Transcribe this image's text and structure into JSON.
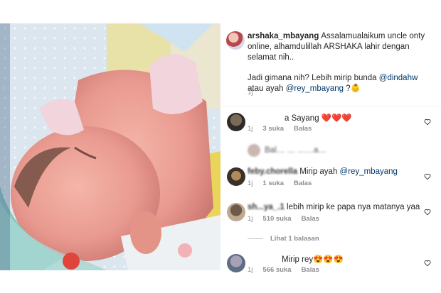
{
  "post": {
    "username": "arshaka_mbayang",
    "caption_line1": "Assalamualaikum uncle onty online,  alhamdulillah ARSHAKA lahir dengan selamat nih..",
    "caption_line2_prefix": "Jadi gimana nih? Lebih mirip bunda ",
    "mention_mother": "@dindahw",
    "caption_line2_mid": " atau ayah ",
    "mention_father": "@rey_mbayang",
    "caption_line2_suffix": " ?👶",
    "time": "1j"
  },
  "comments": [
    {
      "user": "",
      "text": "a Sayang ❤️❤️❤️",
      "time": "1j",
      "likes": "3 suka",
      "reply": "Balas"
    },
    {
      "user": "",
      "text": "Bal… … ……a…",
      "time": "",
      "likes": "",
      "reply": ""
    },
    {
      "user": "feby.chorella",
      "text": "Mirip ayah ",
      "mention": "@rey_mbayang",
      "time": "1j",
      "likes": "1 suka",
      "reply": "Balas"
    },
    {
      "user": "sh...ya_.1",
      "text": "lebih mirip ke papa nya matanya yaa",
      "time": "1j",
      "likes": "510 suka",
      "reply": "Balas"
    },
    {
      "user": "",
      "text": "Mirip rey😍😍😍",
      "time": "1j",
      "likes": "566 suka",
      "reply": "Balas"
    }
  ],
  "view_replies": "Lihat 1 balasan",
  "icons": {
    "like": "heart-outline-icon"
  },
  "colors": {
    "mention": "#00376b",
    "muted": "#8e8e8e",
    "text": "#262626"
  }
}
